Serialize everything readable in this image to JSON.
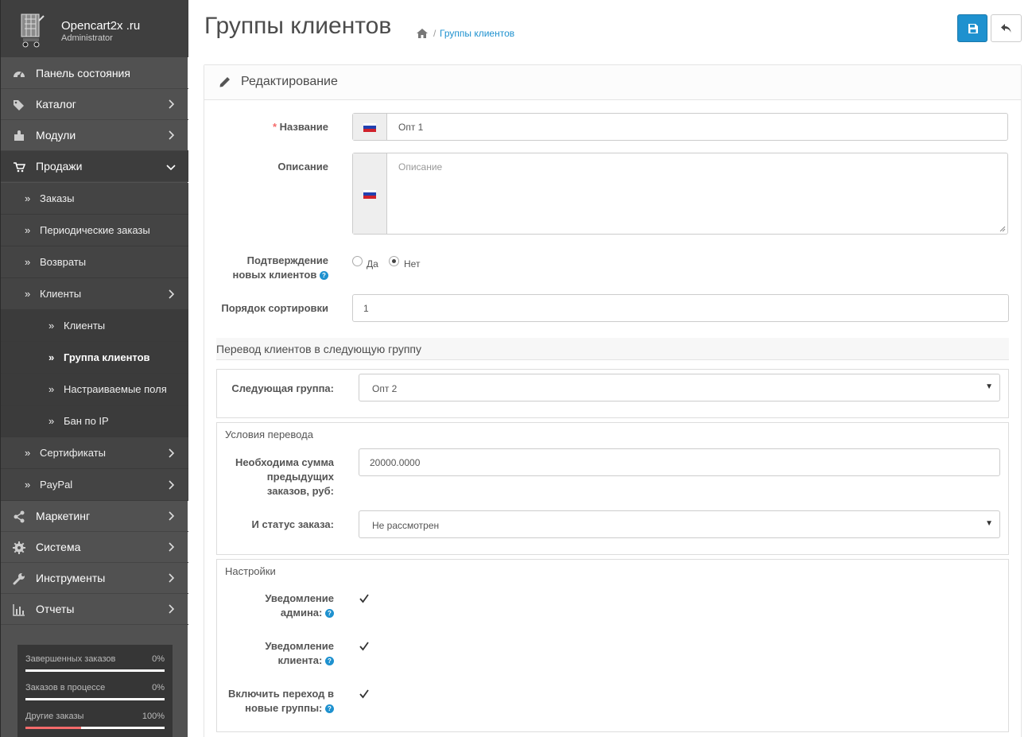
{
  "brand": {
    "name": "Opencart2x .ru",
    "role": "Administrator"
  },
  "nav": {
    "dashboard": "Панель состояния",
    "catalog": "Каталог",
    "modules": "Модули",
    "sales": "Продажи",
    "orders": "Заказы",
    "recurring": "Периодические заказы",
    "returns": "Возвраты",
    "customers": "Клиенты",
    "customers_sub": "Клиенты",
    "customer_groups": "Группа клиентов",
    "custom_fields": "Настраиваемые поля",
    "ip_ban": "Бан по IP",
    "vouchers": "Сертификаты",
    "paypal": "PayPal",
    "marketing": "Маркетинг",
    "system": "Система",
    "tools": "Инструменты",
    "reports": "Отчеты"
  },
  "stats": [
    {
      "label": "Завершенных заказов",
      "value": "0%",
      "fill": 0,
      "color": "#ffffff"
    },
    {
      "label": "Заказов в процессе",
      "value": "0%",
      "fill": 0,
      "color": "#ffffff"
    },
    {
      "label": "Другие заказы",
      "value": "100%",
      "fill": 0.4,
      "color": "#f56b6b"
    }
  ],
  "header": {
    "title": "Группы клиентов",
    "breadcrumb": "Группы клиентов",
    "separator": "/"
  },
  "panel": {
    "title": "Редактирование"
  },
  "form": {
    "name_label": "Название",
    "name_value": "Опт 1",
    "desc_label": "Описание",
    "desc_placeholder": "Описание",
    "approve_label_1": "Подтверждение",
    "approve_label_2": "новых клиентов",
    "approve_yes": "Да",
    "approve_no": "Нет",
    "approve_selected": "no",
    "sort_label": "Порядок сортировки",
    "sort_value": "1"
  },
  "transfer": {
    "section_title": "Перевод клиентов в следующую группу",
    "next_group_label": "Следующая группа:",
    "next_group_value": "Опт 2",
    "conditions_legend": "Условия перевода",
    "sum_label_1": "Необходима сумма",
    "sum_label_2": "предыдущих",
    "sum_label_3": "заказов, руб:",
    "sum_value": "20000.0000",
    "status_label": "И статус заказа:",
    "status_value": "Не рассмотрен",
    "settings_legend": "Настройки",
    "notify_admin_1": "Уведомление",
    "notify_admin_2": "админа:",
    "notify_client_1": "Уведомление",
    "notify_client_2": "клиента:",
    "enable_1": "Включить переход в",
    "enable_2": "новые группы:",
    "help_mark": "?"
  },
  "colors": {
    "accent": "#1e91cf",
    "sidebar": "#515151",
    "danger": "#f56b6b"
  }
}
